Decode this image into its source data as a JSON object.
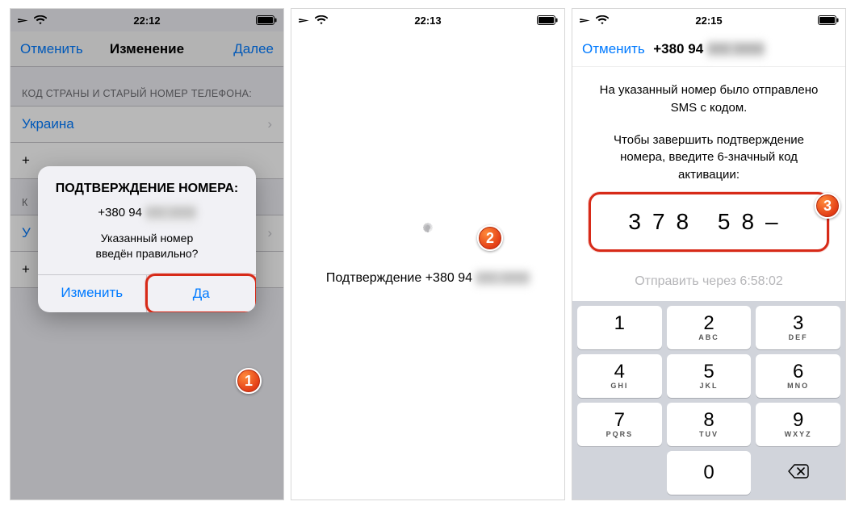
{
  "s1": {
    "time": "22:12",
    "cancel": "Отменить",
    "title": "Изменение",
    "next": "Далее",
    "section_old": "КОД СТРАНЫ И СТАРЫЙ НОМЕР ТЕЛЕФОНА:",
    "country": "Украина",
    "section_new_prefix": "К",
    "country2_prefix": "У",
    "plus": "+",
    "alert": {
      "title": "ПОДТВЕРЖДЕНИЕ НОМЕРА:",
      "phone_prefix": "+380 94 ",
      "phone_blur": "000 0000",
      "q1": "Указанный номер",
      "q2": "введён правильно?",
      "edit": "Изменить",
      "yes": "Да"
    },
    "badge": "1"
  },
  "s2": {
    "time": "22:13",
    "confirm_prefix": "Подтверждение +380 94 ",
    "confirm_blur": "000 0000",
    "badge": "2"
  },
  "s3": {
    "time": "22:15",
    "cancel": "Отменить",
    "title_prefix": "+380 94 ",
    "title_blur": "000 0000",
    "msg1": "На указанный номер было отправлено SMS с кодом.",
    "msg2a": "Чтобы завершить подтверждение номера, введите 6-значный код активации:",
    "code_display": "378 58–",
    "resend": "Отправить через 6:58:02",
    "badge": "3",
    "keys": {
      "k1": "1",
      "k2": "2",
      "k3": "3",
      "k4": "4",
      "k5": "5",
      "k6": "6",
      "k7": "7",
      "k8": "8",
      "k9": "9",
      "k0": "0",
      "s2": "ABC",
      "s3": "DEF",
      "s4": "GHI",
      "s5": "JKL",
      "s6": "MNO",
      "s7": "PQRS",
      "s8": "TUV",
      "s9": "WXYZ"
    }
  }
}
